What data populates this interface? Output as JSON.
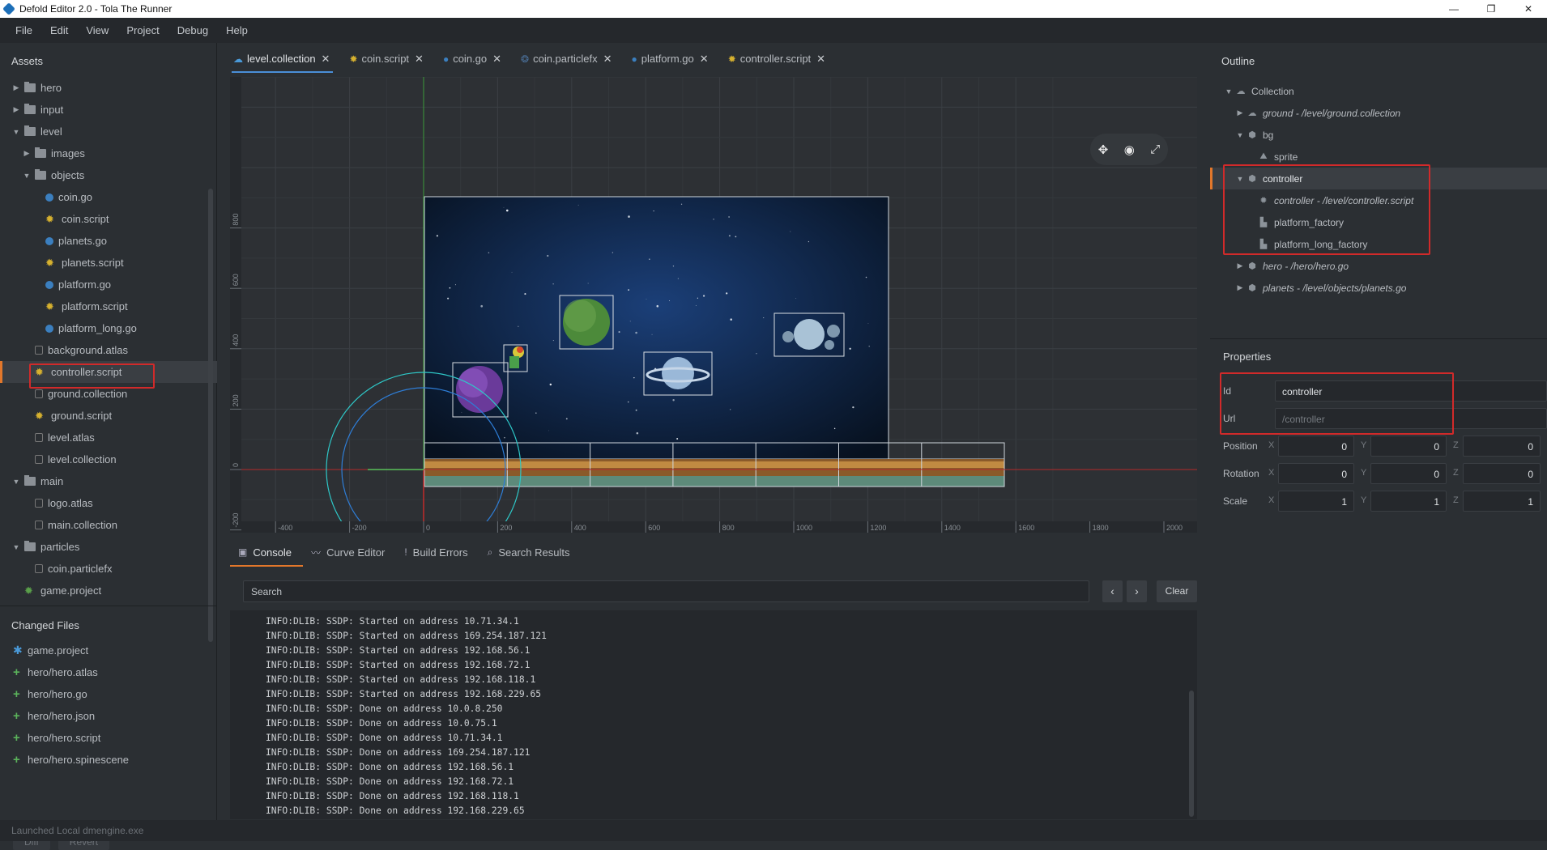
{
  "window": {
    "title": "Defold Editor 2.0 - Tola The Runner",
    "buttons": [
      "—",
      "❐",
      "✕"
    ]
  },
  "menu": [
    "File",
    "Edit",
    "View",
    "Project",
    "Debug",
    "Help"
  ],
  "assets": {
    "title": "Assets",
    "items": [
      {
        "label": "hero",
        "depth": 1,
        "arrow": "▶",
        "icon": "folder"
      },
      {
        "label": "input",
        "depth": 1,
        "arrow": "▶",
        "icon": "folder"
      },
      {
        "label": "level",
        "depth": 1,
        "arrow": "▼",
        "icon": "folder"
      },
      {
        "label": "images",
        "depth": 2,
        "arrow": "▶",
        "icon": "folder"
      },
      {
        "label": "objects",
        "depth": 2,
        "arrow": "▼",
        "icon": "folder"
      },
      {
        "label": "coin.go",
        "depth": 3,
        "arrow": "",
        "icon": "go"
      },
      {
        "label": "coin.script",
        "depth": 3,
        "arrow": "",
        "icon": "script"
      },
      {
        "label": "planets.go",
        "depth": 3,
        "arrow": "",
        "icon": "go"
      },
      {
        "label": "planets.script",
        "depth": 3,
        "arrow": "",
        "icon": "script"
      },
      {
        "label": "platform.go",
        "depth": 3,
        "arrow": "",
        "icon": "go"
      },
      {
        "label": "platform.script",
        "depth": 3,
        "arrow": "",
        "icon": "script"
      },
      {
        "label": "platform_long.go",
        "depth": 3,
        "arrow": "",
        "icon": "go"
      },
      {
        "label": "background.atlas",
        "depth": 2,
        "arrow": "",
        "icon": "plain"
      },
      {
        "label": "controller.script",
        "depth": 2,
        "arrow": "",
        "icon": "script",
        "selected": true
      },
      {
        "label": "ground.collection",
        "depth": 2,
        "arrow": "",
        "icon": "plain"
      },
      {
        "label": "ground.script",
        "depth": 2,
        "arrow": "",
        "icon": "script"
      },
      {
        "label": "level.atlas",
        "depth": 2,
        "arrow": "",
        "icon": "plain"
      },
      {
        "label": "level.collection",
        "depth": 2,
        "arrow": "",
        "icon": "plain"
      },
      {
        "label": "main",
        "depth": 1,
        "arrow": "▼",
        "icon": "folder"
      },
      {
        "label": "logo.atlas",
        "depth": 2,
        "arrow": "",
        "icon": "plain"
      },
      {
        "label": "main.collection",
        "depth": 2,
        "arrow": "",
        "icon": "plain"
      },
      {
        "label": "particles",
        "depth": 1,
        "arrow": "▼",
        "icon": "folder"
      },
      {
        "label": "coin.particlefx",
        "depth": 2,
        "arrow": "",
        "icon": "plain"
      },
      {
        "label": "game.project",
        "depth": 1,
        "arrow": "",
        "icon": "project"
      }
    ]
  },
  "changed_files": {
    "title": "Changed Files",
    "items": [
      {
        "label": "game.project",
        "mark": "✱"
      },
      {
        "label": "hero/hero.atlas",
        "mark": "+"
      },
      {
        "label": "hero/hero.go",
        "mark": "+"
      },
      {
        "label": "hero/hero.json",
        "mark": "+"
      },
      {
        "label": "hero/hero.script",
        "mark": "+"
      },
      {
        "label": "hero/hero.spinescene",
        "mark": "+"
      }
    ],
    "diff_label": "Diff",
    "revert_label": "Revert"
  },
  "tabs": [
    {
      "label": "level.collection",
      "icon": "collection-icon",
      "active": true
    },
    {
      "label": "coin.script",
      "icon": "script-icon"
    },
    {
      "label": "coin.go",
      "icon": "go-icon"
    },
    {
      "label": "coin.particlefx",
      "icon": "particlefx-icon"
    },
    {
      "label": "platform.go",
      "icon": "go-icon"
    },
    {
      "label": "controller.script",
      "icon": "script-icon"
    }
  ],
  "viewport": {
    "x_ticks": [
      "-400",
      "-200",
      "0",
      "200",
      "400",
      "600",
      "800",
      "1000",
      "1200",
      "1400",
      "1600",
      "1800",
      "2000"
    ],
    "y_ticks": [
      "800",
      "600",
      "400",
      "200",
      "0",
      "-200"
    ],
    "tools": [
      "move-tool",
      "rotate-tool",
      "scale-tool"
    ]
  },
  "bottom_tabs": [
    {
      "label": "Console",
      "active": true
    },
    {
      "label": "Curve Editor"
    },
    {
      "label": "Build Errors"
    },
    {
      "label": "Search Results"
    }
  ],
  "console": {
    "search_placeholder": "Search",
    "clear_label": "Clear",
    "lines": [
      "INFO:DLIB: SSDP: Started on address 10.71.34.1",
      "INFO:DLIB: SSDP: Started on address 169.254.187.121",
      "INFO:DLIB: SSDP: Started on address 192.168.56.1",
      "INFO:DLIB: SSDP: Started on address 192.168.72.1",
      "INFO:DLIB: SSDP: Started on address 192.168.118.1",
      "INFO:DLIB: SSDP: Started on address 192.168.229.65",
      "INFO:DLIB: SSDP: Done on address 10.0.8.250",
      "INFO:DLIB: SSDP: Done on address 10.0.75.1",
      "INFO:DLIB: SSDP: Done on address 10.71.34.1",
      "INFO:DLIB: SSDP: Done on address 169.254.187.121",
      "INFO:DLIB: SSDP: Done on address 192.168.56.1",
      "INFO:DLIB: SSDP: Done on address 192.168.72.1",
      "INFO:DLIB: SSDP: Done on address 192.168.118.1",
      "INFO:DLIB: SSDP: Done on address 192.168.229.65"
    ]
  },
  "outline": {
    "title": "Outline",
    "items": [
      {
        "label": "Collection",
        "depth": 0,
        "arrow": "▼",
        "icon": "collection"
      },
      {
        "label": "ground - /level/ground.collection",
        "depth": 1,
        "arrow": "▶",
        "icon": "collection",
        "italic": true
      },
      {
        "label": "bg",
        "depth": 1,
        "arrow": "▼",
        "icon": "go"
      },
      {
        "label": "sprite",
        "depth": 2,
        "arrow": "",
        "icon": "sprite"
      },
      {
        "label": "controller",
        "depth": 1,
        "arrow": "▼",
        "icon": "go",
        "selected": true
      },
      {
        "label": "controller - /level/controller.script",
        "depth": 2,
        "arrow": "",
        "icon": "script",
        "italic": true
      },
      {
        "label": "platform_factory",
        "depth": 2,
        "arrow": "",
        "icon": "factory"
      },
      {
        "label": "platform_long_factory",
        "depth": 2,
        "arrow": "",
        "icon": "factory"
      },
      {
        "label": "hero - /hero/hero.go",
        "depth": 1,
        "arrow": "▶",
        "icon": "go",
        "italic": true
      },
      {
        "label": "planets - /level/objects/planets.go",
        "depth": 1,
        "arrow": "▶",
        "icon": "go",
        "italic": true
      }
    ]
  },
  "properties": {
    "title": "Properties",
    "id_label": "Id",
    "id_value": "controller",
    "url_label": "Url",
    "url_value": "/controller",
    "position_label": "Position",
    "position": [
      "0",
      "0",
      "0"
    ],
    "rotation_label": "Rotation",
    "rotation": [
      "0",
      "0",
      "0"
    ],
    "scale_label": "Scale",
    "scale": [
      "1",
      "1",
      "1"
    ],
    "axes": [
      "X",
      "Y",
      "Z"
    ]
  },
  "status": "Launched Local dmengine.exe",
  "colors": {
    "accent": "#e2772b",
    "highlight": "#d12a2a",
    "tab_underline": "#4a8fd8"
  }
}
